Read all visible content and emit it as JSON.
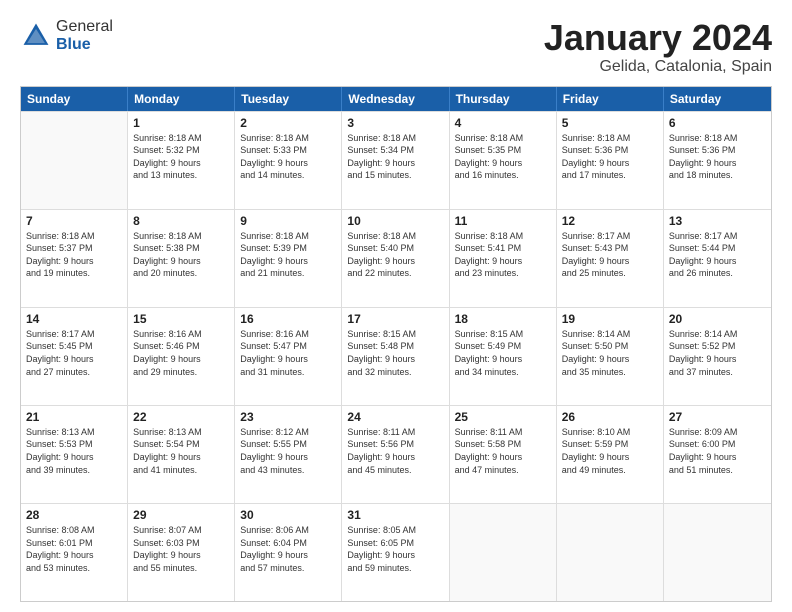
{
  "logo": {
    "general": "General",
    "blue": "Blue"
  },
  "title": "January 2024",
  "subtitle": "Gelida, Catalonia, Spain",
  "header_days": [
    "Sunday",
    "Monday",
    "Tuesday",
    "Wednesday",
    "Thursday",
    "Friday",
    "Saturday"
  ],
  "weeks": [
    [
      {
        "day": "",
        "info": ""
      },
      {
        "day": "1",
        "info": "Sunrise: 8:18 AM\nSunset: 5:32 PM\nDaylight: 9 hours\nand 13 minutes."
      },
      {
        "day": "2",
        "info": "Sunrise: 8:18 AM\nSunset: 5:33 PM\nDaylight: 9 hours\nand 14 minutes."
      },
      {
        "day": "3",
        "info": "Sunrise: 8:18 AM\nSunset: 5:34 PM\nDaylight: 9 hours\nand 15 minutes."
      },
      {
        "day": "4",
        "info": "Sunrise: 8:18 AM\nSunset: 5:35 PM\nDaylight: 9 hours\nand 16 minutes."
      },
      {
        "day": "5",
        "info": "Sunrise: 8:18 AM\nSunset: 5:36 PM\nDaylight: 9 hours\nand 17 minutes."
      },
      {
        "day": "6",
        "info": "Sunrise: 8:18 AM\nSunset: 5:36 PM\nDaylight: 9 hours\nand 18 minutes."
      }
    ],
    [
      {
        "day": "7",
        "info": "Sunrise: 8:18 AM\nSunset: 5:37 PM\nDaylight: 9 hours\nand 19 minutes."
      },
      {
        "day": "8",
        "info": "Sunrise: 8:18 AM\nSunset: 5:38 PM\nDaylight: 9 hours\nand 20 minutes."
      },
      {
        "day": "9",
        "info": "Sunrise: 8:18 AM\nSunset: 5:39 PM\nDaylight: 9 hours\nand 21 minutes."
      },
      {
        "day": "10",
        "info": "Sunrise: 8:18 AM\nSunset: 5:40 PM\nDaylight: 9 hours\nand 22 minutes."
      },
      {
        "day": "11",
        "info": "Sunrise: 8:18 AM\nSunset: 5:41 PM\nDaylight: 9 hours\nand 23 minutes."
      },
      {
        "day": "12",
        "info": "Sunrise: 8:17 AM\nSunset: 5:43 PM\nDaylight: 9 hours\nand 25 minutes."
      },
      {
        "day": "13",
        "info": "Sunrise: 8:17 AM\nSunset: 5:44 PM\nDaylight: 9 hours\nand 26 minutes."
      }
    ],
    [
      {
        "day": "14",
        "info": "Sunrise: 8:17 AM\nSunset: 5:45 PM\nDaylight: 9 hours\nand 27 minutes."
      },
      {
        "day": "15",
        "info": "Sunrise: 8:16 AM\nSunset: 5:46 PM\nDaylight: 9 hours\nand 29 minutes."
      },
      {
        "day": "16",
        "info": "Sunrise: 8:16 AM\nSunset: 5:47 PM\nDaylight: 9 hours\nand 31 minutes."
      },
      {
        "day": "17",
        "info": "Sunrise: 8:15 AM\nSunset: 5:48 PM\nDaylight: 9 hours\nand 32 minutes."
      },
      {
        "day": "18",
        "info": "Sunrise: 8:15 AM\nSunset: 5:49 PM\nDaylight: 9 hours\nand 34 minutes."
      },
      {
        "day": "19",
        "info": "Sunrise: 8:14 AM\nSunset: 5:50 PM\nDaylight: 9 hours\nand 35 minutes."
      },
      {
        "day": "20",
        "info": "Sunrise: 8:14 AM\nSunset: 5:52 PM\nDaylight: 9 hours\nand 37 minutes."
      }
    ],
    [
      {
        "day": "21",
        "info": "Sunrise: 8:13 AM\nSunset: 5:53 PM\nDaylight: 9 hours\nand 39 minutes."
      },
      {
        "day": "22",
        "info": "Sunrise: 8:13 AM\nSunset: 5:54 PM\nDaylight: 9 hours\nand 41 minutes."
      },
      {
        "day": "23",
        "info": "Sunrise: 8:12 AM\nSunset: 5:55 PM\nDaylight: 9 hours\nand 43 minutes."
      },
      {
        "day": "24",
        "info": "Sunrise: 8:11 AM\nSunset: 5:56 PM\nDaylight: 9 hours\nand 45 minutes."
      },
      {
        "day": "25",
        "info": "Sunrise: 8:11 AM\nSunset: 5:58 PM\nDaylight: 9 hours\nand 47 minutes."
      },
      {
        "day": "26",
        "info": "Sunrise: 8:10 AM\nSunset: 5:59 PM\nDaylight: 9 hours\nand 49 minutes."
      },
      {
        "day": "27",
        "info": "Sunrise: 8:09 AM\nSunset: 6:00 PM\nDaylight: 9 hours\nand 51 minutes."
      }
    ],
    [
      {
        "day": "28",
        "info": "Sunrise: 8:08 AM\nSunset: 6:01 PM\nDaylight: 9 hours\nand 53 minutes."
      },
      {
        "day": "29",
        "info": "Sunrise: 8:07 AM\nSunset: 6:03 PM\nDaylight: 9 hours\nand 55 minutes."
      },
      {
        "day": "30",
        "info": "Sunrise: 8:06 AM\nSunset: 6:04 PM\nDaylight: 9 hours\nand 57 minutes."
      },
      {
        "day": "31",
        "info": "Sunrise: 8:05 AM\nSunset: 6:05 PM\nDaylight: 9 hours\nand 59 minutes."
      },
      {
        "day": "",
        "info": ""
      },
      {
        "day": "",
        "info": ""
      },
      {
        "day": "",
        "info": ""
      }
    ]
  ]
}
